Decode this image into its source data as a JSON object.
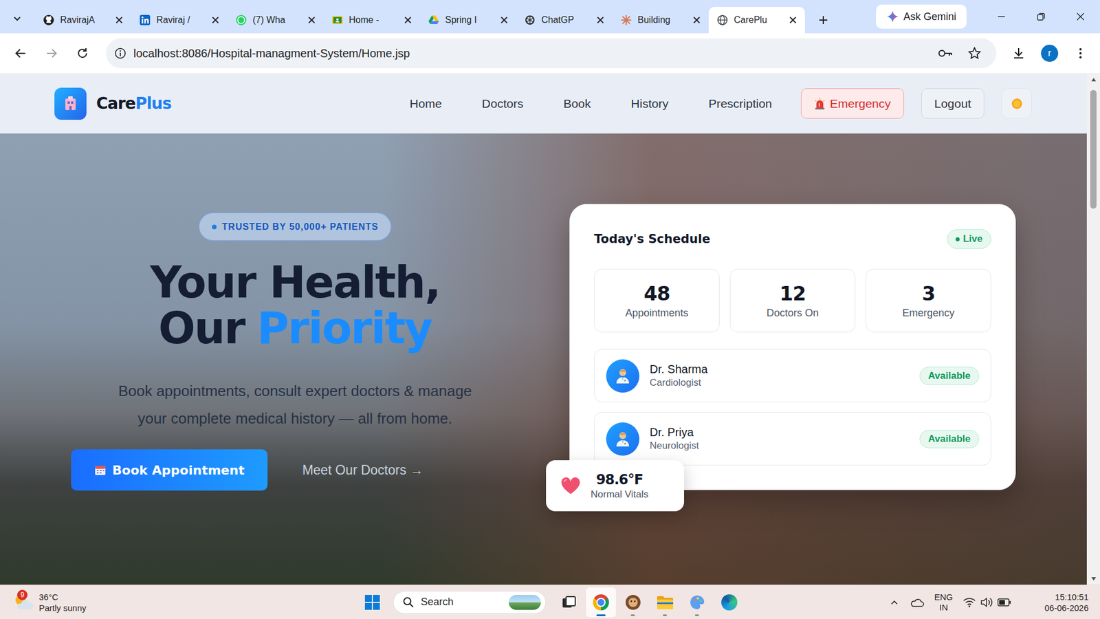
{
  "browser": {
    "tabs": [
      {
        "label": "RavirajA",
        "kind": "github",
        "selected": false
      },
      {
        "label": "Raviraj /",
        "kind": "linkedin",
        "selected": false
      },
      {
        "label": "(7) Wha",
        "kind": "whatsapp",
        "selected": false
      },
      {
        "label": "Home -",
        "kind": "classroom",
        "selected": false
      },
      {
        "label": "Spring I",
        "kind": "drive",
        "selected": false
      },
      {
        "label": "ChatGP",
        "kind": "chatgpt",
        "selected": false
      },
      {
        "label": "Building",
        "kind": "claude",
        "selected": false
      },
      {
        "label": "CarePlu",
        "kind": "globe",
        "selected": true
      }
    ],
    "gemini": "Ask Gemini",
    "url": "localhost:8086/Hospital-managment-System/Home.jsp",
    "profile": "r"
  },
  "navbar": {
    "logo_first": "Care",
    "logo_second": "Plus",
    "links": [
      "Home",
      "Doctors",
      "Book",
      "History",
      "Prescription"
    ],
    "emergency": "Emergency",
    "logout": "Logout"
  },
  "hero": {
    "badge": "TRUSTED BY 50,000+ PATIENTS",
    "title_line1": "Your Health,",
    "title_line2": "Our",
    "title_highlight": "Priority",
    "subtitle": "Book appointments, consult expert doctors & manage your complete medical history — all from home.",
    "primary_button": "Book Appointment",
    "secondary_button": "Meet Our Doctors →"
  },
  "schedule": {
    "title": "Today's Schedule",
    "live": "Live",
    "stats": [
      {
        "value": "48",
        "label": "Appointments"
      },
      {
        "value": "12",
        "label": "Doctors On"
      },
      {
        "value": "3",
        "label": "Emergency"
      }
    ],
    "doctors": [
      {
        "name": "Dr. Sharma",
        "specialty": "Cardiologist",
        "status": "Available"
      },
      {
        "name": "Dr. Priya",
        "specialty": "Neurologist",
        "status": "Available"
      }
    ]
  },
  "vitals": {
    "value": "98.6°F",
    "label": "Normal Vitals"
  },
  "taskbar": {
    "weather": {
      "badge": "9",
      "temp": "36°C",
      "condition": "Partly sunny"
    },
    "search": "Search",
    "apps": [
      {
        "kind": "taskview",
        "selected": false,
        "running": false
      },
      {
        "kind": "chrome",
        "selected": true,
        "running": true
      },
      {
        "kind": "game",
        "selected": false,
        "running": true
      },
      {
        "kind": "files",
        "selected": false,
        "running": true
      },
      {
        "kind": "paint",
        "selected": false,
        "running": true
      },
      {
        "kind": "edge",
        "selected": false,
        "running": false
      }
    ],
    "language": "ENG",
    "region": "IN",
    "time": "15:10:51",
    "date": "06-06-2026"
  }
}
